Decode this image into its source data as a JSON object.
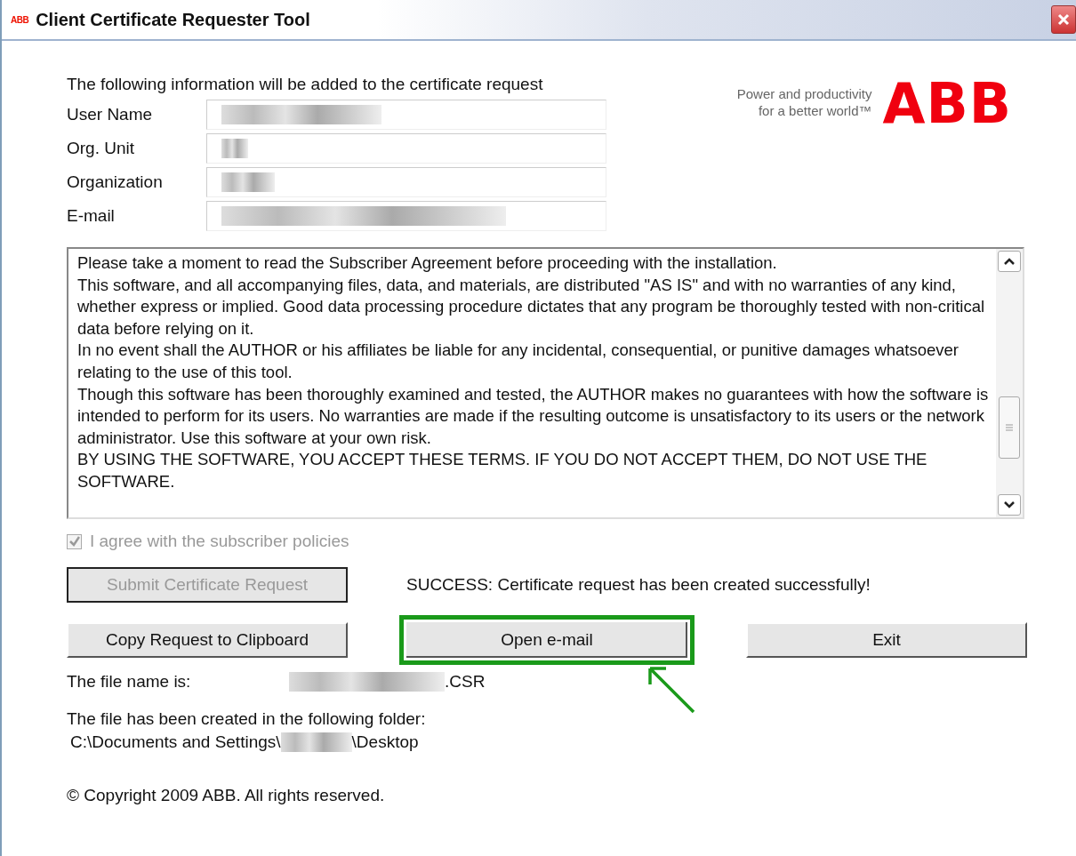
{
  "window": {
    "logo": "ABB",
    "title": "Client Certificate Requester Tool"
  },
  "intro": "The following information will be added to the certificate request",
  "brand": {
    "tagline_1": "Power and productivity",
    "tagline_2": "for a better world™",
    "logo": "ABB"
  },
  "fields": [
    {
      "label": "User Name"
    },
    {
      "label": "Org. Unit"
    },
    {
      "label": "Organization"
    },
    {
      "label": "E-mail"
    }
  ],
  "agreement": [
    "Please take a moment to read the Subscriber Agreement before proceeding with the installation.",
    "This software, and all accompanying files, data, and materials, are distributed \"AS IS\" and with no warranties of any kind, whether express or implied. Good data processing procedure dictates that any program be thoroughly tested with non-critical data before relying on it.",
    "In no event shall the AUTHOR or his affiliates be liable for any incidental, consequential, or punitive damages whatsoever relating to the use of this tool.",
    "Though this software has been thoroughly examined and tested, the AUTHOR makes no guarantees with how the software is intended to perform for its users. No warranties are made if the resulting outcome is unsatisfactory to its users or the network administrator. Use this software at your own risk.",
    "BY USING THE SOFTWARE, YOU ACCEPT THESE TERMS.  IF YOU DO NOT ACCEPT THEM, DO NOT USE THE SOFTWARE."
  ],
  "agree": {
    "label": "I agree with the subscriber policies",
    "checked": true,
    "disabled": true
  },
  "submit": {
    "label": "Submit Certificate Request",
    "disabled": true
  },
  "status": "SUCCESS: Certificate request has been created successfully!",
  "buttons": [
    {
      "label": "Copy Request to Clipboard",
      "highlighted": false
    },
    {
      "label": "Open e-mail",
      "highlighted": true
    },
    {
      "label": "Exit",
      "highlighted": false
    }
  ],
  "file_name": {
    "label": "The file name is:",
    "suffix": ".CSR"
  },
  "folder": {
    "label": "The file has been created in the following folder:",
    "path_start": "C:\\Documents and Settings\\",
    "path_end": "\\Desktop"
  },
  "copyright": "© Copyright 2009 ABB. All rights reserved."
}
